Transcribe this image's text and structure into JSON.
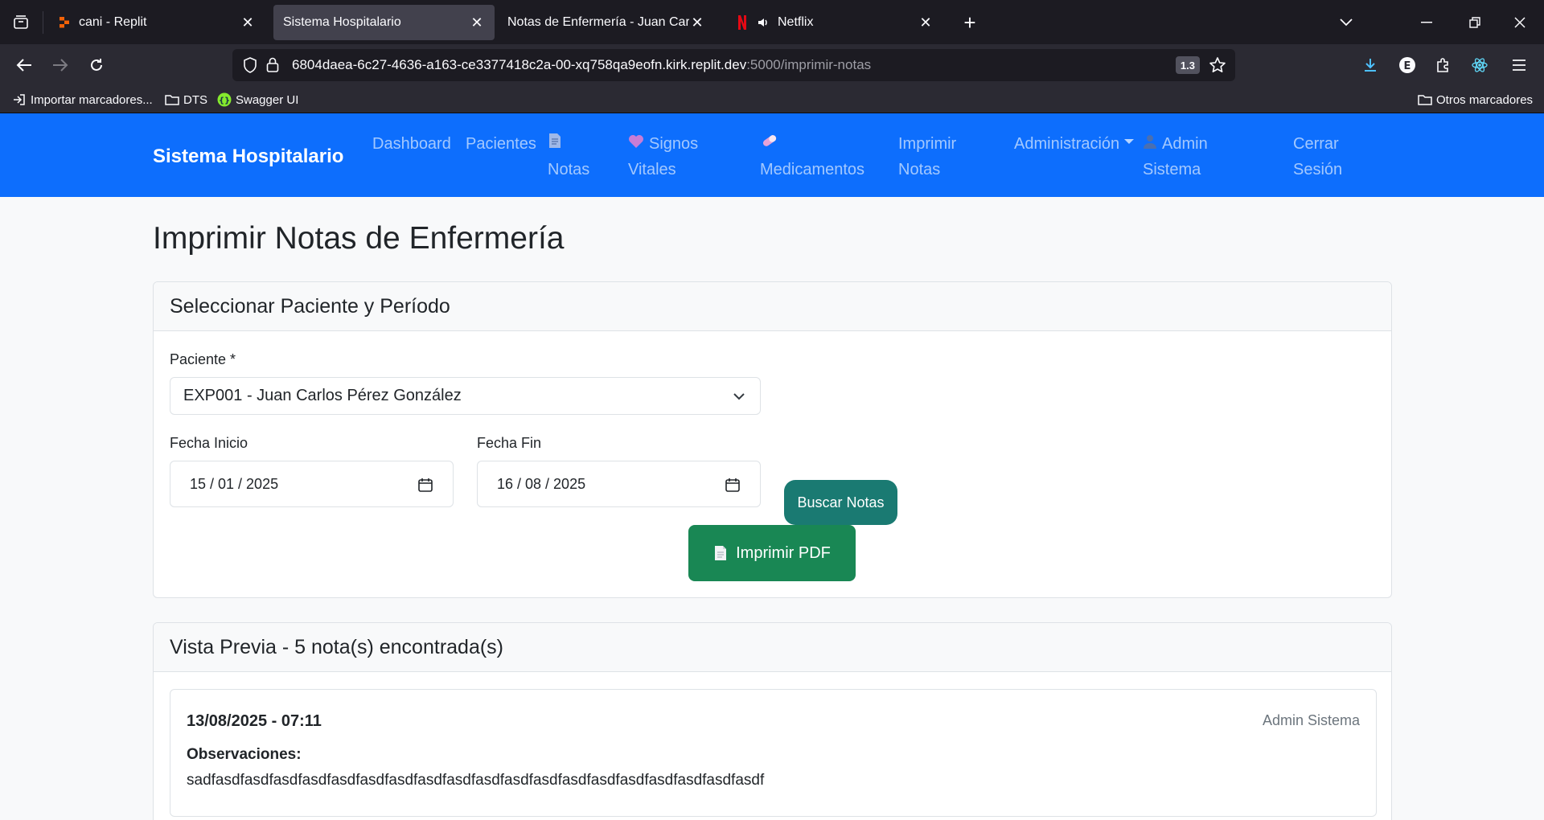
{
  "browser": {
    "tabs": [
      {
        "title": "cani - Replit"
      },
      {
        "title": "Sistema Hospitalario"
      },
      {
        "title": "Notas de Enfermería - Juan Carlos Pérez"
      },
      {
        "title": "Netflix"
      }
    ],
    "url_main": "6804daea-6c27-4636-a163-ce3377418c2a-00-xq758qa9eofn.kirk.replit.dev",
    "url_path": ":5000/imprimir-notas",
    "zoom": "1.3",
    "bookmarks": [
      "Importar marcadores...",
      "DTS",
      "Swagger UI"
    ],
    "other_bookmarks": "Otros marcadores",
    "colors": {
      "tabbar": "#1c1b22",
      "toolbar": "#2b2a33",
      "active_tab": "#42414d"
    }
  },
  "app": {
    "brand": "Sistema Hospitalario",
    "nav": {
      "dashboard": "Dashboard",
      "pacientes": "Pacientes",
      "notas": "Notas",
      "signos_1": "Signos",
      "signos_2": "Vitales",
      "medicamentos": "Medicamentos",
      "imprimir_1": "Imprimir",
      "imprimir_2": "Notas",
      "administracion": "Administración",
      "admin_1": "Admin",
      "admin_2": "Sistema",
      "cerrar_1": "Cerrar",
      "cerrar_2": "Sesión"
    },
    "colors": {
      "primary": "#0d6efd",
      "teal_button": "#1a7a72",
      "success_button": "#198754"
    }
  },
  "page": {
    "title": "Imprimir Notas de Enfermería",
    "select_card": {
      "header": "Seleccionar Paciente y Período",
      "patient_label": "Paciente *",
      "patient_value": "EXP001 - Juan Carlos Pérez González",
      "start_label": "Fecha Inicio",
      "start_value": "15 / 01 / 2025",
      "end_label": "Fecha Fin",
      "end_value": "16 / 08 / 2025",
      "search_button": "Buscar Notas",
      "print_button": "Imprimir PDF"
    },
    "preview_card": {
      "header": "Vista Previa - 5 nota(s) encontrada(s)",
      "note": {
        "datetime": "13/08/2025 - 07:11",
        "author": "Admin Sistema",
        "obs_label": "Observaciones:",
        "obs_text": "sadfasdfasdfasdfasdfasdfasdfasdfasdfasdfasdfasdfasdfasdfasdfasdfasdfasdfasdfasdf"
      }
    }
  }
}
